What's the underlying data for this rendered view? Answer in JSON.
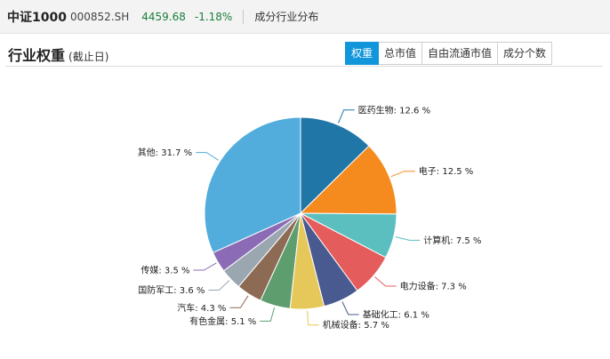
{
  "header": {
    "index_name": "中证1000",
    "index_code": "000852.SH",
    "price": "4459.68",
    "change": "-1.18%",
    "section": "成分行业分布"
  },
  "panel": {
    "title": "行业权重",
    "subtitle": "(截止日)",
    "tabs": [
      {
        "label": "权重",
        "active": true
      },
      {
        "label": "总市值",
        "active": false
      },
      {
        "label": "自由流通市值",
        "active": false
      },
      {
        "label": "成分个数",
        "active": false
      }
    ]
  },
  "colors": {
    "accent": "#1296db",
    "change_green": "#1a7f3c"
  },
  "chart_data": {
    "type": "pie",
    "unit": "%",
    "slices": [
      {
        "label": "医药生物",
        "value": 12.6,
        "color": "#2176a8"
      },
      {
        "label": "电子",
        "value": 12.5,
        "color": "#f58b1f"
      },
      {
        "label": "计算机",
        "value": 7.5,
        "color": "#5bbfc0"
      },
      {
        "label": "电力设备",
        "value": 7.3,
        "color": "#e55c5c"
      },
      {
        "label": "基础化工",
        "value": 6.1,
        "color": "#485a90"
      },
      {
        "label": "机械设备",
        "value": 5.7,
        "color": "#e6c85a"
      },
      {
        "label": "有色金属",
        "value": 5.1,
        "color": "#5e9e6e"
      },
      {
        "label": "汽车",
        "value": 4.3,
        "color": "#8d6a54"
      },
      {
        "label": "国防军工",
        "value": 3.6,
        "color": "#9aa6b0"
      },
      {
        "label": "传媒",
        "value": 3.5,
        "color": "#8b6bb5"
      },
      {
        "label": "其他",
        "value": 31.7,
        "color": "#52acdc"
      }
    ]
  }
}
